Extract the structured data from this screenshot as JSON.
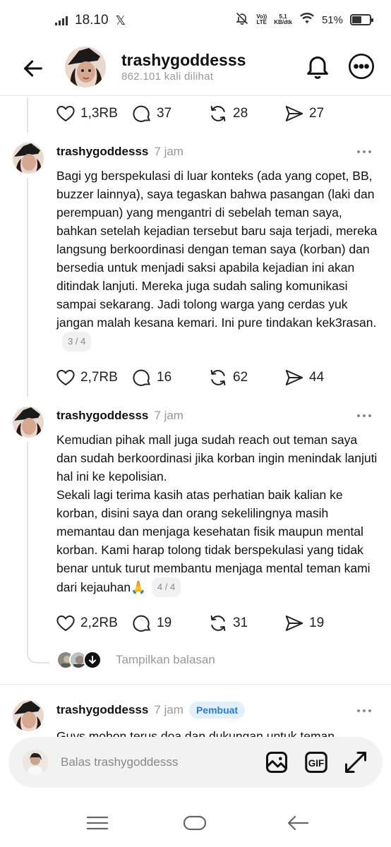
{
  "status_bar": {
    "time": "18.10",
    "x_logo": "𝕏",
    "net_speed_top": "5,1",
    "net_speed_bottom": "KB/dtk",
    "volte_top": "Vo))",
    "volte_bottom": "LTE",
    "battery": "51%",
    "battery_level": 0.51,
    "icons": [
      "signal-icon",
      "x-logo-icon",
      "mute-icon",
      "volte-icon",
      "wifi-icon",
      "battery-icon"
    ]
  },
  "header": {
    "username": "trashygoddesss",
    "views": "862.101 kali dilihat",
    "icons": [
      "back-arrow-icon",
      "bell-icon",
      "more-icon"
    ]
  },
  "top_actions": {
    "likes": "1,3RB",
    "replies": "37",
    "reposts": "28",
    "shares": "27"
  },
  "posts": [
    {
      "username": "trashygoddesss",
      "time": "7 jam",
      "text": "Bagi yg berspekulasi di luar konteks (ada yang copet, BB, buzzer lainnya), saya tegaskan bahwa pasangan (laki dan perempuan) yang mengantri di sebelah teman saya, bahkan setelah kejadian tersebut baru saja terjadi, mereka langsung berkoordinasi dengan teman saya (korban) dan bersedia untuk menjadi saksi apabila kejadian ini akan ditindak lanjuti. Mereka juga sudah saling komunikasi sampai sekarang. Jadi tolong warga yang cerdas yuk jangan malah kesana kemari. Ini pure tindakan kek3rasan.",
      "counter": "3 / 4",
      "likes": "2,7RB",
      "replies": "16",
      "reposts": "62",
      "shares": "44"
    },
    {
      "username": "trashygoddesss",
      "time": "7 jam",
      "text_line1": "Kemudian pihak mall juga sudah reach out teman saya dan sudah berkoordinasi jika korban ingin menindak lanjuti hal ini ke kepolisian.",
      "text_line2": "Sekali lagi terima kasih atas perhatian baik kalian ke korban, disini saya dan orang sekelilingnya masih memantau dan menjaga kesehatan fisik maupun mental korban. Kami harap tolong tidak berspekulasi yang tidak benar untuk turut membantu menjaga mental teman kami dari kejauhan🙏",
      "counter": "4 / 4",
      "likes": "2,2RB",
      "replies": "19",
      "reposts": "31",
      "shares": "19"
    },
    {
      "username": "trashygoddesss",
      "time": "7 jam",
      "badge": "Pembuat",
      "text": "Guys mohon terus doa dan dukungan untuk teman"
    }
  ],
  "show_replies": "Tampilkan balasan",
  "reply_bar": {
    "placeholder": "Balas trashygoddesss",
    "icons": [
      "image-icon",
      "gif-icon",
      "expand-icon"
    ]
  },
  "nav_bar": {
    "icons": [
      "recents-icon",
      "home-icon",
      "back-icon"
    ]
  },
  "colors": {
    "accent": "#2a7bd0",
    "muted": "#999999",
    "text": "#111111"
  }
}
